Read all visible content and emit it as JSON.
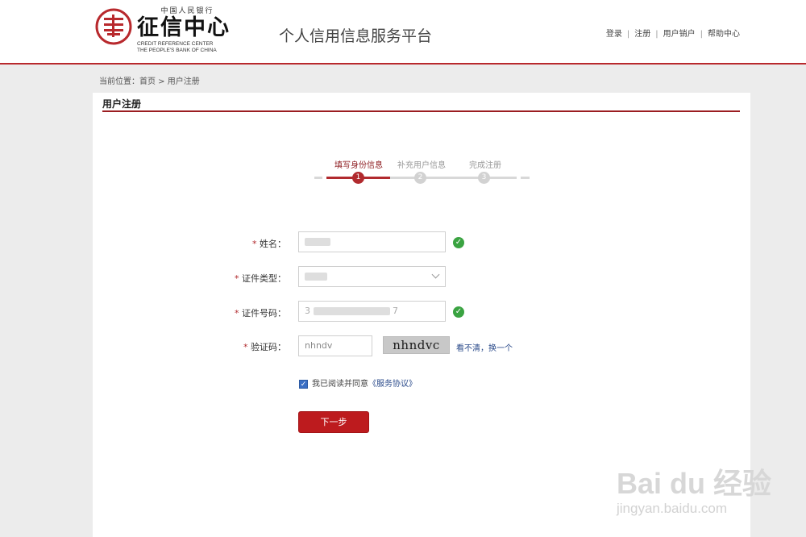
{
  "header": {
    "logo_top": "中国人民银行",
    "logo_main": "征信中心",
    "logo_en_line1": "CREDIT REFERENCE CENTER",
    "logo_en_line2": "THE PEOPLE'S BANK OF CHINA",
    "platform_title": "个人信用信息服务平台",
    "links": [
      "登录",
      "注册",
      "用户销户",
      "帮助中心"
    ],
    "brand_color": "#b8292d"
  },
  "breadcrumb": {
    "prefix": "当前位置：",
    "home": "首页",
    "separator": " > ",
    "current": "用户注册"
  },
  "panel": {
    "title": "用户注册"
  },
  "steps": [
    {
      "label": "填写身份信息",
      "number": "1",
      "active": true
    },
    {
      "label": "补充用户信息",
      "number": "2",
      "active": false
    },
    {
      "label": "完成注册",
      "number": "3",
      "active": false
    }
  ],
  "form": {
    "name": {
      "label": "姓名：",
      "required_mark": "* ",
      "valid": true
    },
    "id_type": {
      "label": "证件类型：",
      "required_mark": "* "
    },
    "id_number": {
      "label": "证件号码：",
      "required_mark": "* ",
      "value_start": "3",
      "value_end": "7",
      "valid": true
    },
    "captcha": {
      "label": "验证码：",
      "required_mark": "* ",
      "value": "nhndv",
      "image_text": "nhndvc",
      "refresh_text": "看不清，换一个"
    },
    "agree": {
      "checked": true,
      "text": "我已阅读并同意",
      "link": "《服务协议》"
    },
    "submit_label": "下一步"
  },
  "icons": {
    "valid": "check-circle-icon",
    "select": "chevron-down-icon",
    "checkbox": "checkbox-checked-icon"
  },
  "watermark": {
    "main": "Bai du 经验",
    "sub": "jingyan.baidu.com"
  }
}
